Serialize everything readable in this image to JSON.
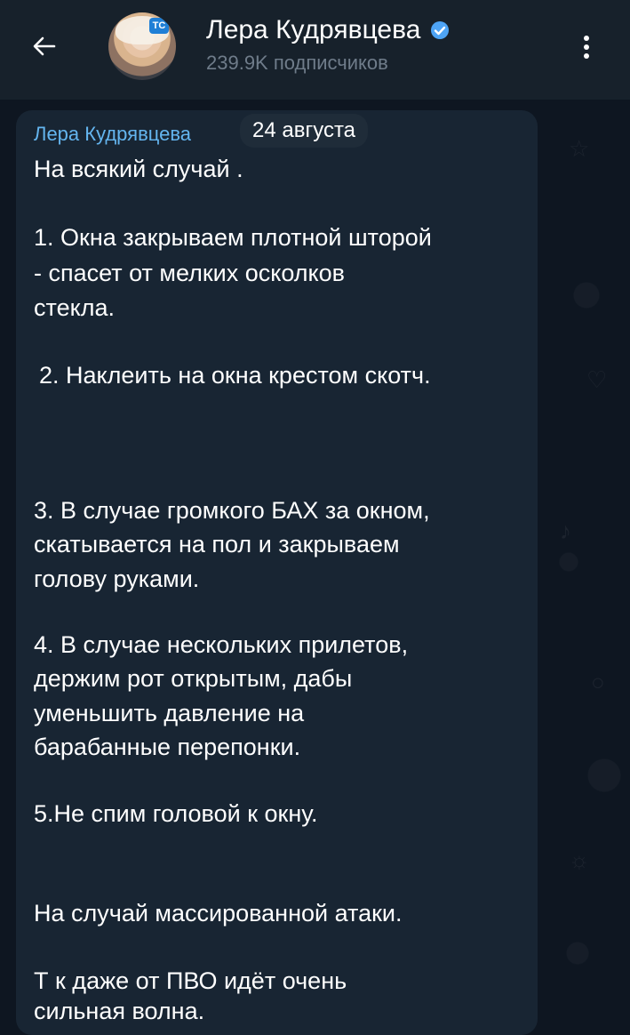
{
  "header": {
    "channel_name": "Лера Кудрявцева",
    "subscribers": "239.9K подписчиков",
    "avatar_badge": "TC",
    "back_icon": "arrow-left-icon",
    "menu_icon": "more-vertical-icon",
    "verified_icon": "verified-check-icon",
    "accent_color": "#64b5ef"
  },
  "message": {
    "author": "Лера Кудрявцева",
    "date": "24 августа",
    "lines": [
      "На всякий случай .",
      "1. Окна закрываем плотной шторой",
      "- спасет от мелких осколков",
      "стекла.",
      "2. Наклеить на окна крестом скотч.",
      "3. В случае громкого БАХ за окном,",
      "скатывается на пол и закрываем",
      "голову руками.",
      "4. В случае нескольких прилетов,",
      "держим рот открытым, дабы",
      "уменьшить давление на",
      "барабанные перепонки.",
      "5.Не спим головой к окну.",
      "На случай массированной атаки.",
      "Т к даже от ПВО идёт очень",
      "сильная волна."
    ]
  }
}
